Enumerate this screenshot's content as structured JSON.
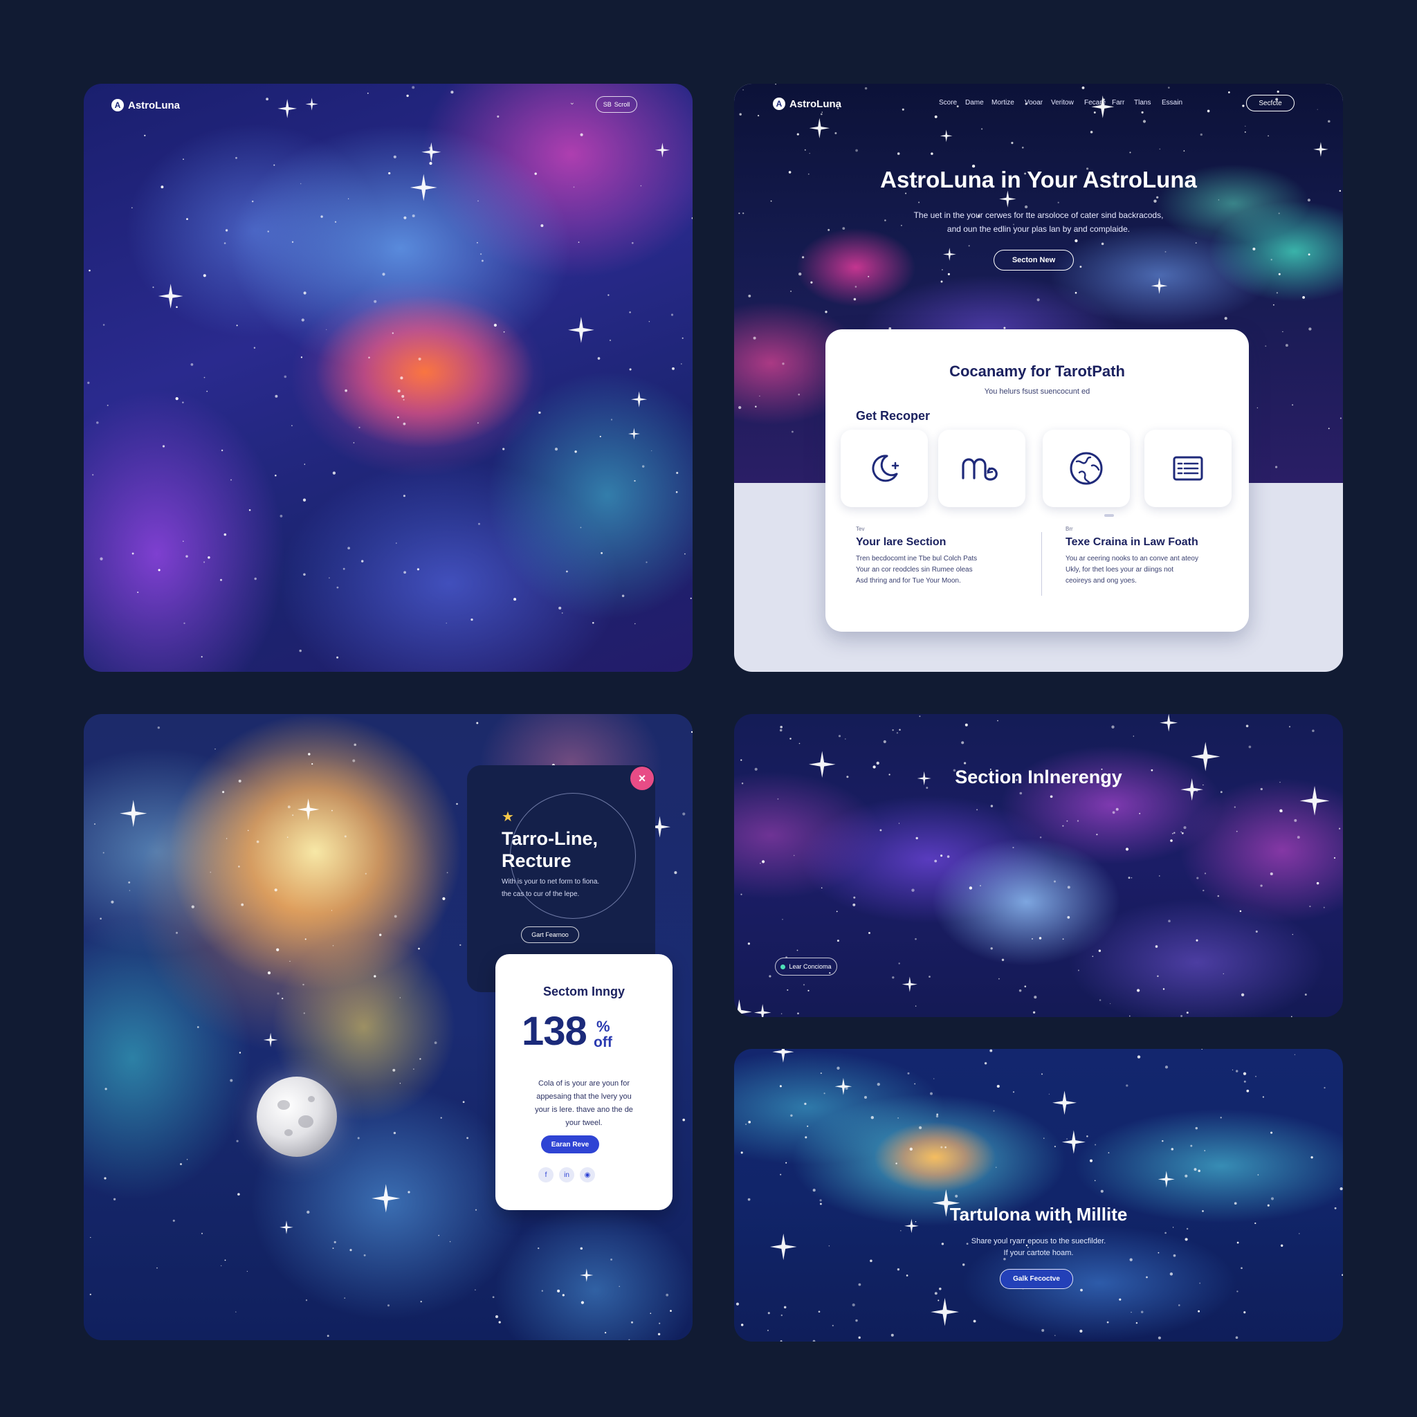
{
  "panel_a": {
    "brand": "AstroLuna",
    "logo_glyph": "A",
    "pill_label": "Scroll",
    "pill_icon": "SB",
    "arrow": "⌄"
  },
  "panel_b": {
    "brand": "AstroLuna",
    "logo_glyph": "A",
    "nav_links": [
      "Score",
      "Dame",
      "Mortize",
      "Vooar",
      "Veritow",
      "Fecare",
      "Farr",
      "Tlans",
      "Essain"
    ],
    "nav_button": "Secfcte",
    "hero_title": "AstroLuna in Your AstroLuna",
    "hero_sub_line1": "The uet in the your cerwes for tte arsoloce of cater sind backracods,",
    "hero_sub_line2": "and oun the edlin your plas lan by and complaide.",
    "hero_button": "Secton New",
    "card": {
      "title": "Cocanamy for TarotPath",
      "subtitle": "You helurs fsust suencocunt ed",
      "section_label": "Get Recoper",
      "icons": [
        "moon-icon",
        "zodiac-icon",
        "globe-icon",
        "list-card-icon"
      ],
      "col1_label": "Tev",
      "col1_title": "Your lare Section",
      "col1_body": [
        "Tren becdocomt ine Tbe bul Colch Pats",
        "Your an cor reodcles sin Rumee oleas",
        "Asd thring and for Tue Your Moon."
      ],
      "col2_label": "Brr",
      "col2_title": "Texe Craina in Law Foath",
      "col2_body": [
        "You ar ceering nooks to an conve ant ateoy",
        "Ukly, for thet loes your ar diings not",
        "ceoireys and ong yoes."
      ]
    }
  },
  "panel_c": {
    "offer_title_line1": "Tarro-Line,",
    "offer_title_line2": "Recture",
    "offer_body_line1": "With is your to net form to fiona.",
    "offer_body_line2": "the cas to cur of the lepe.",
    "offer_button": "Gart Fearnoo",
    "close_glyph": "×",
    "discount_title": "Sectom Inngy",
    "discount_value": "138",
    "discount_percent": "%",
    "discount_off": "off",
    "discount_body": [
      "Cola of is your are youn for",
      "appesaing that the lvery you",
      "your is lere. thave ano the de",
      "your tweel."
    ],
    "discount_button": "Earan Reve",
    "social_icons": [
      "f",
      "in",
      "◉"
    ]
  },
  "panel_d": {
    "title": "Section Inlnerengy",
    "button": "Lear Concioma"
  },
  "panel_e": {
    "title": "Tartulona with Millite",
    "sub_line1": "Share youl ryarr epous to the suecfilder.",
    "sub_line2": "If your cartote hoam.",
    "button": "Galk Fecoctve"
  },
  "colors": {
    "page_bg": "#111b33",
    "accent_blue": "#2f44d4",
    "close_pink": "#e84c86",
    "card_navy": "#14204a"
  }
}
